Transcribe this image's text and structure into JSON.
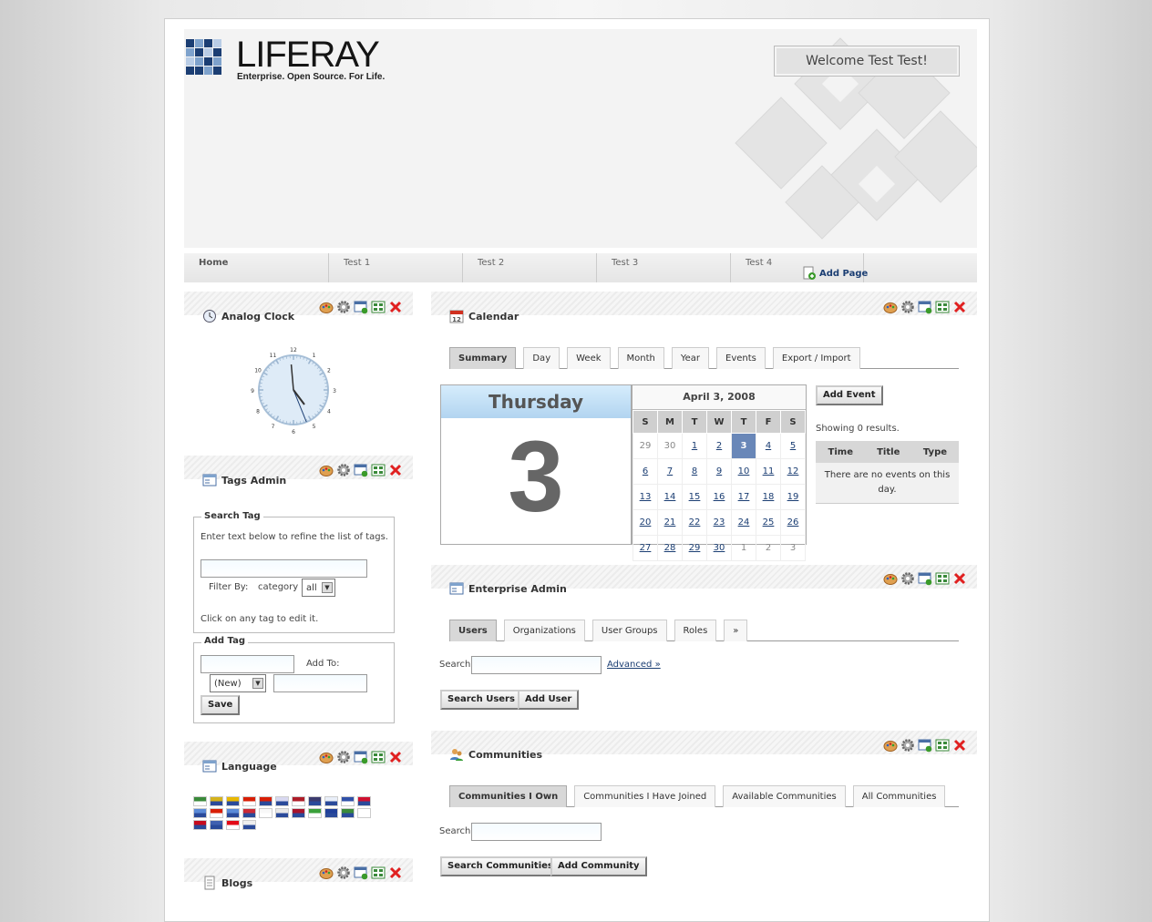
{
  "header": {
    "logo_text": "LIFERAY",
    "logo_tagline": "Enterprise. Open Source. For Life.",
    "welcome": "Welcome Test Test!"
  },
  "nav": {
    "items": [
      "Home",
      "Test 1",
      "Test 2",
      "Test 3",
      "Test 4"
    ],
    "add_page": "Add Page"
  },
  "clock": {
    "title": "Analog Clock",
    "numbers": [
      "12",
      "1",
      "2",
      "3",
      "4",
      "5",
      "6",
      "7",
      "8",
      "9",
      "10",
      "11"
    ]
  },
  "tags_admin": {
    "title": "Tags Admin",
    "search_legend": "Search Tag",
    "search_hint": "Enter text below to refine the list of tags.",
    "filter_label": "Filter By:",
    "filter_field": "category",
    "filter_value": "all",
    "click_hint": "Click on any tag to edit it.",
    "add_legend": "Add Tag",
    "add_to_label": "Add To:",
    "new_value": "(New)",
    "save": "Save"
  },
  "language": {
    "title": "Language",
    "flag_colors": [
      "#3a8a3a",
      "#d4b21c",
      "#e8b800",
      "#d81e05",
      "#d81e05",
      "#d8d8f0",
      "#ae1c28",
      "#3c3b6e",
      "#e8eef8",
      "#3050a8",
      "#cf1030",
      "#5a8ad8",
      "#d81e05",
      "#5a8ad8",
      "#cc2a36",
      "#f8f8f8",
      "#e8e8e8",
      "#a8142c",
      "#3aa03a",
      "#20409a",
      "#3a8a3a",
      "#ffffff",
      "#c60b1e",
      "#4060b0",
      "#e30a17",
      "#eeeeee"
    ]
  },
  "blogs": {
    "title": "Blogs"
  },
  "calendar": {
    "title": "Calendar",
    "tabs": [
      "Summary",
      "Day",
      "Week",
      "Month",
      "Year",
      "Events",
      "Export / Import"
    ],
    "day_name": "Thursday",
    "day_number": "3",
    "month_label": "April 3, 2008",
    "weekdays": [
      "S",
      "M",
      "T",
      "W",
      "T",
      "F",
      "S"
    ],
    "weeks": [
      [
        "29",
        "30",
        "1",
        "2",
        "3",
        "4",
        "5"
      ],
      [
        "6",
        "7",
        "8",
        "9",
        "10",
        "11",
        "12"
      ],
      [
        "13",
        "14",
        "15",
        "16",
        "17",
        "18",
        "19"
      ],
      [
        "20",
        "21",
        "22",
        "23",
        "24",
        "25",
        "26"
      ],
      [
        "27",
        "28",
        "29",
        "30",
        "1",
        "2",
        "3"
      ]
    ],
    "add_event": "Add Event",
    "showing": "Showing 0 results.",
    "columns": [
      "Time",
      "Title",
      "Type"
    ],
    "empty": "There are no events on this day."
  },
  "enterprise_admin": {
    "title": "Enterprise Admin",
    "tabs": [
      "Users",
      "Organizations",
      "User Groups",
      "Roles",
      "»"
    ],
    "search_label": "Search",
    "advanced": "Advanced »",
    "search_users": "Search Users",
    "add_user": "Add User"
  },
  "communities": {
    "title": "Communities",
    "tabs": [
      "Communities I Own",
      "Communities I Have Joined",
      "Available Communities",
      "All Communities"
    ],
    "search_label": "Search",
    "search_button": "Search Communities",
    "add_button": "Add Community"
  }
}
